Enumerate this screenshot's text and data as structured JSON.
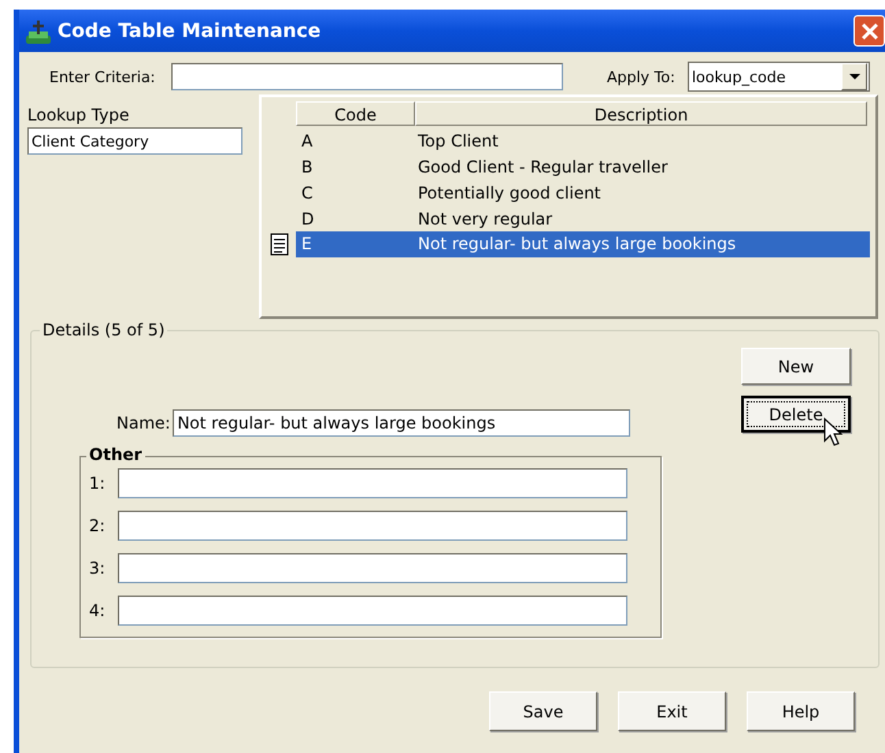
{
  "window": {
    "title": "Code Table Maintenance"
  },
  "criteria": {
    "label": "Enter Criteria:"
  },
  "apply_to": {
    "label": "Apply To:",
    "value": "lookup_code"
  },
  "lookup_type": {
    "label": "Lookup Type",
    "value": "Client Category"
  },
  "table": {
    "columns": [
      "Code",
      "Description"
    ],
    "rows": [
      {
        "code": "A",
        "description": "Top Client",
        "selected": false
      },
      {
        "code": "B",
        "description": "Good Client - Regular traveller",
        "selected": false
      },
      {
        "code": "C",
        "description": "Potentially good client",
        "selected": false
      },
      {
        "code": "D",
        "description": "Not very regular",
        "selected": false
      },
      {
        "code": "E",
        "description": "Not regular- but always large bookings",
        "selected": true
      }
    ]
  },
  "details": {
    "title": "Details (5 of 5)",
    "name_label": "Name:",
    "name_value": "Not regular- but always large bookings",
    "buttons": [
      {
        "label": "New",
        "focused": false
      },
      {
        "label": "Delete",
        "focused": true
      }
    ],
    "other": {
      "title": "Other",
      "fields": [
        {
          "label": "1:"
        },
        {
          "label": "2:"
        },
        {
          "label": "3:"
        },
        {
          "label": "4:"
        }
      ]
    }
  },
  "buttons": [
    "Save",
    "Exit",
    "Help"
  ]
}
